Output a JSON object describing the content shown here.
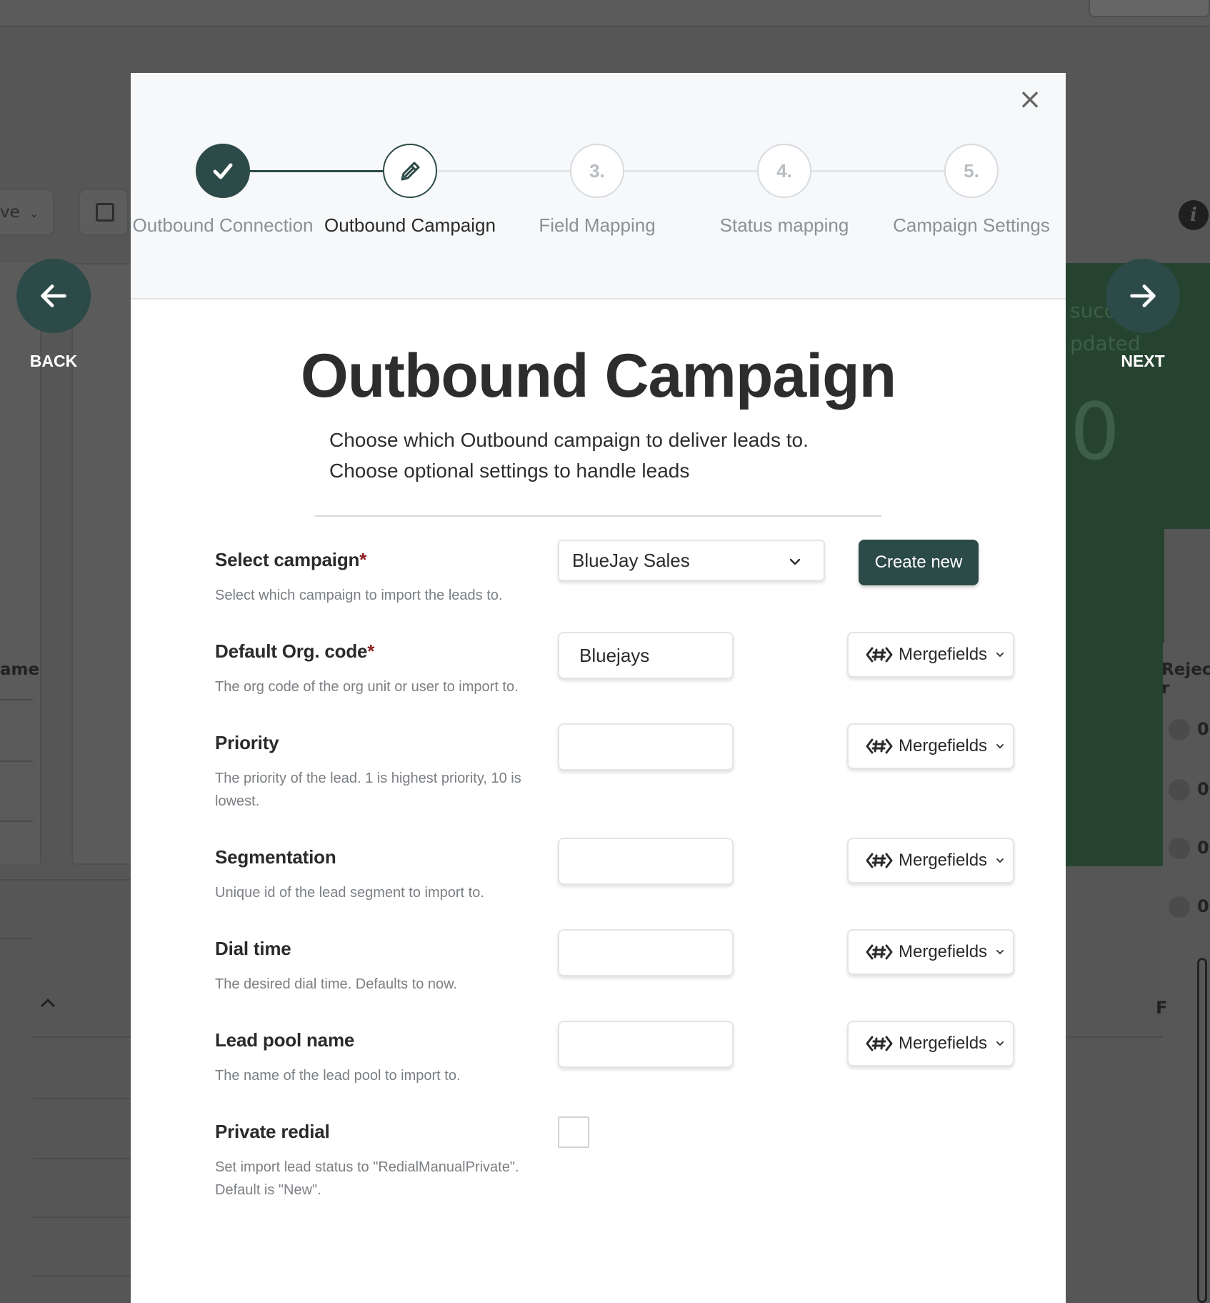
{
  "background": {
    "select_text": "ve",
    "label_name": "ame",
    "label_reject": "Reject r",
    "green_text_1": "succ",
    "green_text_2": "pdated",
    "green_big": "0",
    "row_values": [
      "0",
      "0",
      "0",
      "0"
    ],
    "col_label_r": "F"
  },
  "nav": {
    "back_label": "BACK",
    "next_label": "NEXT"
  },
  "modal": {
    "close_glyph": "×",
    "steps": [
      {
        "number": "✓",
        "label": "Outbound Connection",
        "state": "done"
      },
      {
        "number": "",
        "label": "Outbound Campaign",
        "state": "current"
      },
      {
        "number": "3.",
        "label": "Field Mapping",
        "state": "todo"
      },
      {
        "number": "4.",
        "label": "Status mapping",
        "state": "todo"
      },
      {
        "number": "5.",
        "label": "Campaign Settings",
        "state": "todo"
      }
    ],
    "title": "Outbound Campaign",
    "description": "Choose which Outbound campaign to deliver leads to. Choose optional settings to handle leads"
  },
  "form": {
    "required_mark": "*",
    "mergefields_label": "Mergefields",
    "select_campaign": {
      "label": "Select campaign",
      "help": "Select which campaign to import the leads to.",
      "value": "BlueJay Sales",
      "create_label": "Create new"
    },
    "org_code": {
      "label": "Default Org. code",
      "help": "The org code of the org unit or user to import to.",
      "value": "Bluejays"
    },
    "priority": {
      "label": "Priority",
      "help": "The priority of the lead. 1 is highest priority, 10 is lowest.",
      "value": ""
    },
    "segmentation": {
      "label": "Segmentation",
      "help": "Unique id of the lead segment to import to.",
      "value": ""
    },
    "dial_time": {
      "label": "Dial time",
      "help": "The desired dial time. Defaults to now.",
      "value": ""
    },
    "lead_pool": {
      "label": "Lead pool name",
      "help": "The name of the lead pool to import to.",
      "value": ""
    },
    "private_redial": {
      "label": "Private redial",
      "help": "Set import lead status to \"RedialManualPrivate\". Default is \"New\".",
      "checked": false
    }
  },
  "colors": {
    "accent": "#2c4a47",
    "required": "#8b1e1e",
    "overlay": "#565656",
    "bg_green": "#26432f"
  }
}
